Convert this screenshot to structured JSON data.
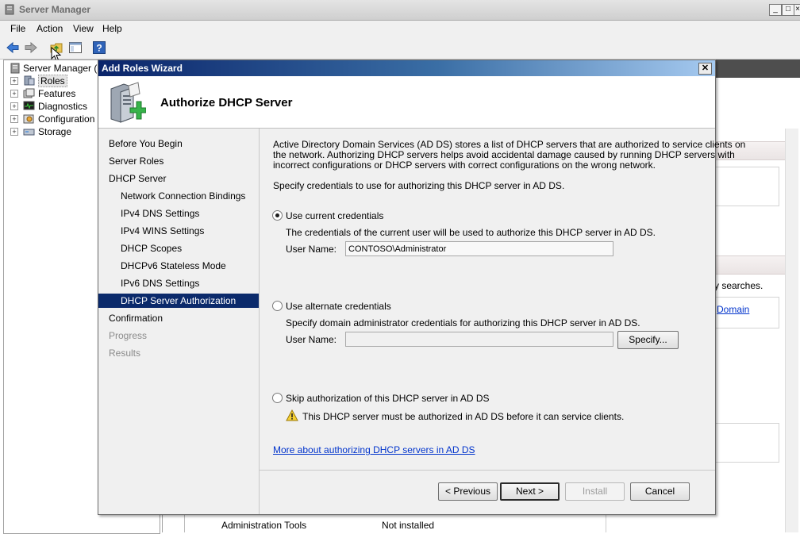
{
  "window": {
    "title": "Server Manager",
    "menu": [
      "File",
      "Action",
      "View",
      "Help"
    ]
  },
  "tree": {
    "root": "Server Manager (SE",
    "items": [
      {
        "label": "Roles",
        "icon": "roles-icon"
      },
      {
        "label": "Features",
        "icon": "features-icon"
      },
      {
        "label": "Diagnostics",
        "icon": "diagnostics-icon"
      },
      {
        "label": "Configuration",
        "icon": "configuration-icon"
      },
      {
        "label": "Storage",
        "icon": "storage-icon"
      }
    ]
  },
  "background": {
    "searches_text": "y searches.",
    "domain_link": "Domain",
    "bottom_row": {
      "name": "Administration Tools",
      "status": "Not installed"
    }
  },
  "wizard": {
    "title": "Add Roles Wizard",
    "heading": "Authorize DHCP Server",
    "nav": [
      {
        "label": "Before You Begin",
        "state": "normal",
        "indent": false
      },
      {
        "label": "Server Roles",
        "state": "normal",
        "indent": false
      },
      {
        "label": "DHCP Server",
        "state": "normal",
        "indent": false
      },
      {
        "label": "Network Connection Bindings",
        "state": "normal",
        "indent": true
      },
      {
        "label": "IPv4 DNS Settings",
        "state": "normal",
        "indent": true
      },
      {
        "label": "IPv4 WINS Settings",
        "state": "normal",
        "indent": true
      },
      {
        "label": "DHCP Scopes",
        "state": "normal",
        "indent": true
      },
      {
        "label": "DHCPv6 Stateless Mode",
        "state": "normal",
        "indent": true
      },
      {
        "label": "IPv6 DNS Settings",
        "state": "normal",
        "indent": true
      },
      {
        "label": "DHCP Server Authorization",
        "state": "active",
        "indent": true
      },
      {
        "label": "Confirmation",
        "state": "normal",
        "indent": false
      },
      {
        "label": "Progress",
        "state": "disabled",
        "indent": false
      },
      {
        "label": "Results",
        "state": "disabled",
        "indent": false
      }
    ],
    "intro_lines": [
      "Active Directory Domain Services (AD DS) stores a list of DHCP servers that are authorized to service clients on",
      "the network. Authorizing DHCP servers helps avoid accidental damage caused by running DHCP servers with",
      "incorrect configurations or DHCP servers with correct configurations on the wrong network."
    ],
    "specify_text": "Specify credentials to use for authorizing this DHCP server in AD DS.",
    "option_current": {
      "label": "Use current credentials",
      "checked": true,
      "description": "The credentials of the current user will be used to authorize this DHCP server in AD DS.",
      "username_label": "User Name:",
      "username_value": "CONTOSO\\Administrator"
    },
    "option_alternate": {
      "label": "Use alternate credentials",
      "checked": false,
      "description": "Specify domain administrator credentials for authorizing this DHCP server in AD DS.",
      "username_label": "User Name:",
      "username_value": "",
      "specify_button": "Specify..."
    },
    "option_skip": {
      "label": "Skip authorization of this DHCP server in AD DS",
      "checked": false,
      "warning": "This DHCP server must be authorized in AD DS before it can service clients."
    },
    "more_link": "More about authorizing DHCP servers in AD DS",
    "buttons": {
      "previous": "< Previous",
      "next": "Next >",
      "install": "Install",
      "cancel": "Cancel"
    }
  },
  "colors": {
    "nav_active_bg": "#0b2a6b",
    "title_gradient_start": "#0a246a",
    "link": "#0033cc"
  }
}
